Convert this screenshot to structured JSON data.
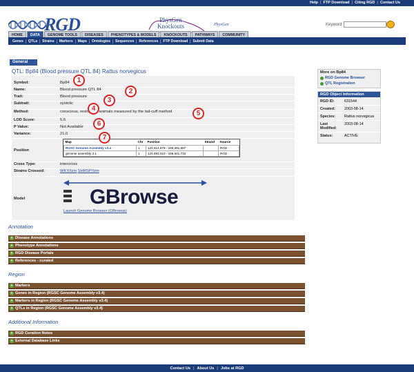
{
  "toplinks": [
    "Help",
    "FTP Download",
    "Citing RGD",
    "Contact Us"
  ],
  "brand": {
    "logo_text": "RGD",
    "physgen_line1": "PhysGen",
    "physgen_line2": "Knockouts",
    "physgen_small": "PhysGen"
  },
  "search": {
    "label": "Keyword",
    "value": ""
  },
  "tabs": [
    "HOME",
    "DATA",
    "GENOME TOOLS",
    "DISEASES",
    "PHENOTYPES & MODELS",
    "KNOCKOUTS",
    "PATHWAYS",
    "COMMUNITY"
  ],
  "active_tab": "DATA",
  "subnav": [
    "Genes",
    "QTLs",
    "Strains",
    "Markers",
    "Maps",
    "Ontologies",
    "Sequences",
    "References",
    "FTP Download",
    "Submit Data"
  ],
  "general_tab": "General",
  "qtl_title": "QTL: Bp84 (Blood pressure QTL 84) Rattus norvegicus",
  "fields": {
    "symbol": {
      "label": "Symbol:",
      "value": "Bp84"
    },
    "name": {
      "label": "Name:",
      "value": "Blood pressure QTL 84"
    },
    "trait": {
      "label": "Trait:",
      "value": "Blood pressure"
    },
    "subtrait": {
      "label": "Subtrait:",
      "value": "systolic"
    },
    "method": {
      "label": "Method:",
      "value": "conscious, restrained animals measured by the tail-cuff method"
    },
    "lod": {
      "label": "LOD Score:",
      "value": "5.6"
    },
    "pvalue": {
      "label": "P Value:",
      "value": "Not Available"
    },
    "variance": {
      "label": "Variance:",
      "value": "21.0"
    },
    "position": {
      "label": "Position"
    },
    "cross": {
      "label": "Cross Type:",
      "value": "intercross"
    },
    "strains": {
      "label": "Strains Crossed:",
      "strain1": "WKY/Izm",
      "strain2": "SHRSP/Izm"
    },
    "model": {
      "label": "Model"
    }
  },
  "position_table": {
    "headers": [
      "Map",
      "Chr",
      "Position",
      "Strand",
      "Source"
    ],
    "rows": [
      [
        "RGSC Genome Assembly v3.4",
        "1",
        "124,614,679 - 186,391,887",
        "",
        "RGD"
      ],
      [
        "genome assembly 3.1",
        "1",
        "124,693,023 - 186,541,733",
        "",
        "RGD"
      ]
    ]
  },
  "gbrowse": {
    "brand": "GBrowse",
    "launch": "Launch Genome Browser (GBrowse)"
  },
  "markers": [
    "1",
    "2",
    "3",
    "4",
    "5",
    "6",
    "7"
  ],
  "more_on": {
    "title": "More on Bp84",
    "links": [
      "RGD Genome Browser",
      "QTL Registration"
    ]
  },
  "object_info": {
    "title": "RGD Object Information",
    "rows": [
      {
        "k": "RGD ID:",
        "v": "631544"
      },
      {
        "k": "Created:",
        "v": "2003-08-14"
      },
      {
        "k": "Species:",
        "v": "Rattus norvegicus"
      },
      {
        "k": "Last Modified:",
        "v": "2003-08-14"
      },
      {
        "k": "Status:",
        "v": "ACTIVE"
      }
    ]
  },
  "annotation": {
    "title": "Annotation",
    "items": [
      "Disease Annotations",
      "Phenotype Annotations",
      "RGD Disease Portals",
      "References - curated"
    ]
  },
  "region": {
    "title": "Region",
    "items": [
      "Markers",
      "Genes in Region (RGSC Genome Assembly v3.4)",
      "Markers in Region (RGSC Genome Assembly v3.4)",
      "QTLs in Region (RGSC Genome Assembly v3.4)"
    ]
  },
  "additional": {
    "title": "Additional Information",
    "items": [
      "RGD Curation Notes",
      "External Database Links"
    ]
  },
  "footer": [
    "Contact Us",
    "About Us",
    "Jobs at RGD"
  ],
  "colors": {
    "nav": "#1a3d7a",
    "section_bar": "#7a5230",
    "accent": "#2a4f9a",
    "marker": "#e02020"
  }
}
